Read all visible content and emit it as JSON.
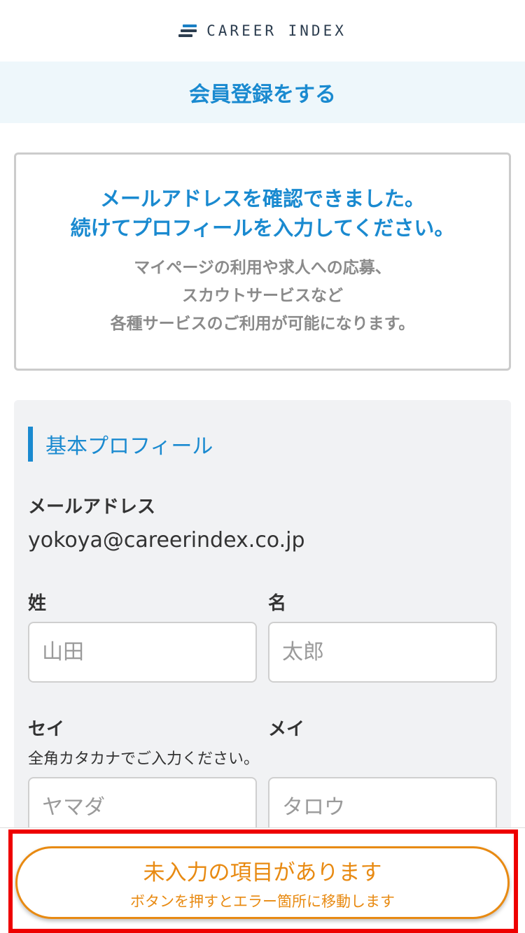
{
  "header": {
    "logo_text": "CAREER INDEX"
  },
  "page_title": "会員登録をする",
  "notice": {
    "lead_line1": "メールアドレスを確認できました。",
    "lead_line2": "続けてプロフィールを入力してください。",
    "sub_line1": "マイページの利用や求人への応募、",
    "sub_line2": "スカウトサービスなど",
    "sub_line3": "各種サービスのご利用が可能になります。"
  },
  "profile": {
    "section_title": "基本プロフィール",
    "email_label": "メールアドレス",
    "email_value": "yokoya@careerindex.co.jp",
    "last_name_label": "姓",
    "first_name_label": "名",
    "last_name_placeholder": "山田",
    "first_name_placeholder": "太郎",
    "last_kana_label": "セイ",
    "first_kana_label": "メイ",
    "kana_hint": "全角カタカナでご入力ください。",
    "last_kana_placeholder": "ヤマダ",
    "first_kana_placeholder": "タロウ"
  },
  "error_button": {
    "main": "未入力の項目があります",
    "sub": "ボタンを押すとエラー箇所に移動します"
  },
  "colors": {
    "accent": "#1a8ad0",
    "warning": "#e88a12",
    "highlight": "#ee0000"
  }
}
